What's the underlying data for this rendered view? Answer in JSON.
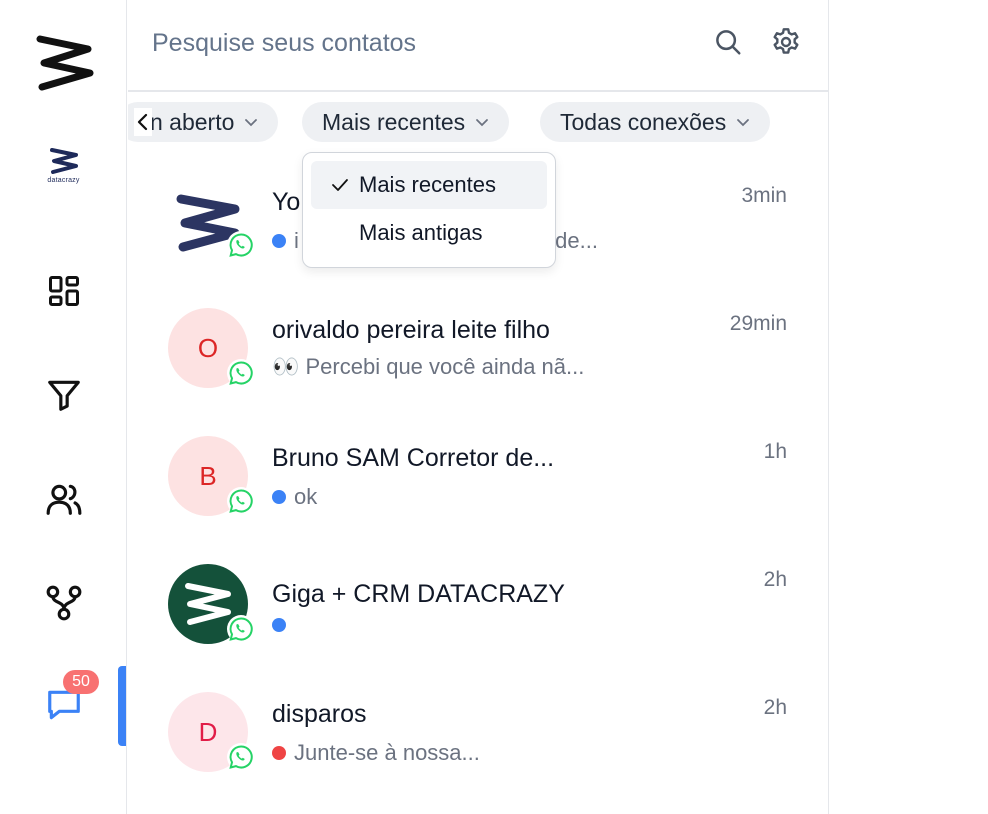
{
  "rail": {
    "badge_count": "50",
    "small_logo_text": "datacrazy"
  },
  "search": {
    "placeholder": "Pesquise seus contatos"
  },
  "filters": {
    "status_chip": "n aberto",
    "sort_chip": "Mais recentes",
    "connections_chip": "Todas conexões"
  },
  "dropdown": {
    "options": [
      {
        "label": "Mais recentes",
        "selected": true
      },
      {
        "label": "Mais antigas",
        "selected": false
      }
    ]
  },
  "conversations": [
    {
      "name": "Yo",
      "preview": "i",
      "preview_tail": "ode...",
      "time": "3min",
      "avatar_type": "logo",
      "dot": "blue"
    },
    {
      "name": "orivaldo pereira leite filho",
      "preview": "👀 Percebi que você ainda nã...",
      "time": "29min",
      "avatar_letter": "O",
      "dot": "none"
    },
    {
      "name": "Bruno SAM Corretor de...",
      "preview": "ok",
      "time": "1h",
      "avatar_letter": "B",
      "dot": "blue"
    },
    {
      "name": "Giga + CRM DATACRAZY",
      "preview": "",
      "time": "2h",
      "avatar_type": "green-logo",
      "dot": "blue"
    },
    {
      "name": "disparos",
      "preview": "Junte-se à nossa...",
      "time": "2h",
      "avatar_letter": "D",
      "dot": "red"
    }
  ],
  "colors": {
    "accent": "#3b82f6",
    "badge": "#f87171",
    "whatsapp": "#25d366",
    "avatar_bg": "#fde2e2",
    "avatar_text": "#dc2626",
    "green_avatar": "#14513a",
    "dot_blue": "#3b82f6",
    "dot_red": "#ef4444"
  }
}
